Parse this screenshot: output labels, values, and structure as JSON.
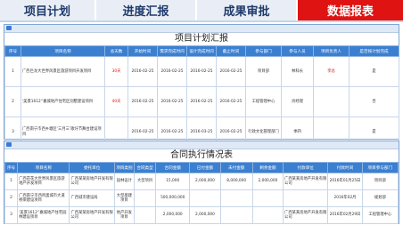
{
  "tabs": [
    {
      "label": "项目计划"
    },
    {
      "label": "进度汇报"
    },
    {
      "label": "成果审批"
    },
    {
      "label": "数据报表"
    }
  ],
  "report1": {
    "title": "项目计划汇报",
    "headers": [
      "序号",
      "项目名称",
      "总天数",
      "开始时间",
      "需求完成时间",
      "设计完成时间",
      "截止时间",
      "参与部门",
      "参与人员",
      "项目负责人",
      "是否按计划完成"
    ],
    "rows": [
      {
        "no": "1",
        "name": "广西巨龙大世界风景区旅游项目开发项目",
        "days": "30天",
        "start": "2016-02-25",
        "req": "2016-02-25",
        "design": "2016-02-25",
        "end": "2016-02-25",
        "dept": "项目部",
        "people": "林科长",
        "owner": "李总",
        "ontime": "是"
      },
      {
        "no": "2",
        "name": "'美景1612'‘嘉城地产住宅区别墅建设项目",
        "days": "40天",
        "start": "2016-02-25",
        "req": "2016-02-25",
        "design": "2016-02-25",
        "end": "2016-02-25",
        "dept": "工程管理中心",
        "people": "肖经理",
        "owner": "",
        "ontime": "否"
      },
      {
        "no": "3",
        "name": "广西南宁市西乡塘区‘三月三’歌圩节舞台建设项目",
        "days": "",
        "start": "2016-02-25",
        "req": "2016-02-25",
        "design": "2016-03-25",
        "end": "2016-02-25",
        "dept": "行政文化管理部门",
        "people": "季四",
        "owner": "",
        "ontime": "是"
      }
    ]
  },
  "report2": {
    "title": "合同执行情况表",
    "headers": [
      "序号",
      "项目名称",
      "委托单位",
      "项目类别",
      "合同类型",
      "合同金额",
      "已付金额",
      "未付金额",
      "剩余金额",
      "付款单位",
      "付款时间",
      "项目参与部门"
    ],
    "rows": [
      {
        "no": "1",
        "name": "广西花花大世界风景区旅游地产开发项目",
        "client": "广西某某房地产开发有限公司",
        "cat": "园林设计",
        "ctype": "大型项目",
        "amount": "15,000",
        "paid": "2,000,000",
        "unpaid": "8,000,000",
        "remain": "2,000,000",
        "payer": "广西某某房地产开发有限公司",
        "date": "2016年01月25日",
        "dept": "项目部"
      },
      {
        "no": "2",
        "name": "广西南宁市西鸡蛋城市大道桥梁建设项目",
        "client": "广西城市建设局",
        "cat": "大型基建项目",
        "ctype": "",
        "amount": "500,000,000",
        "paid": "",
        "unpaid": "",
        "remain": "",
        "payer": "",
        "date": "2016年02月",
        "dept": "规划部"
      },
      {
        "no": "3",
        "name": "'美景1612'‘嘉城地产住宅园林建设项目",
        "client": "广西某某房地产开发有限公司",
        "cat": "地产开发项目",
        "ctype": "",
        "amount": "2,000,000",
        "paid": "2,000,000",
        "unpaid": "",
        "remain": "",
        "payer": "广西某某房地产开发有限公司",
        "date": "2016年02月29日",
        "dept": "工程管理中心"
      }
    ]
  }
}
